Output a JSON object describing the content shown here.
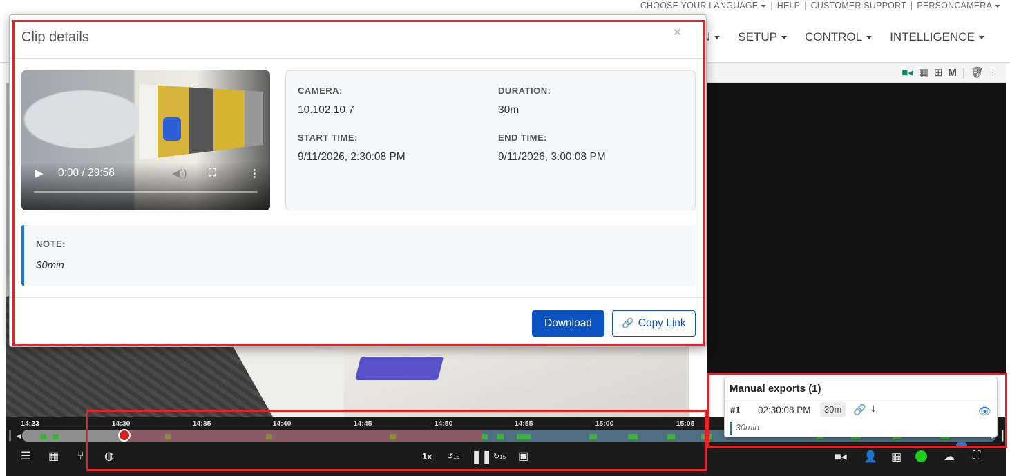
{
  "utility_bar": {
    "language": "CHOOSE YOUR LANGUAGE",
    "help": "HELP",
    "support": "CUSTOMER SUPPORT",
    "user": "PERSONCAMERA"
  },
  "main_nav": {
    "partial": "N",
    "setup": "SETUP",
    "control": "CONTROL",
    "intelligence": "INTELLIGENCE"
  },
  "camera_tools": {
    "m_label": "M"
  },
  "modal": {
    "title": "Clip details",
    "close": "×",
    "video": {
      "time": "0:00 / 29:58"
    },
    "camera_label": "CAMERA:",
    "camera_value": "10.102.10.7",
    "duration_label": "DURATION:",
    "duration_value": "30m",
    "start_label": "START TIME:",
    "start_value": "9/11/2026, 2:30:08 PM",
    "end_label": "END TIME:",
    "end_value": "9/11/2026, 3:00:08 PM",
    "note_label": "NOTE:",
    "note_value": "30min",
    "download": "Download",
    "copy_link": "Copy Link"
  },
  "timeline": {
    "ticks": [
      "14:23",
      "14:30",
      "14:35",
      "14:40",
      "14:45",
      "14:50",
      "14:55",
      "15:00",
      "15:05"
    ],
    "speed": "1x",
    "skip_back": "15",
    "skip_forward": "15"
  },
  "exports": {
    "title": "Manual exports (1)",
    "row": {
      "num": "#1",
      "time": "02:30:08 PM",
      "dur": "30m",
      "note": "30min"
    }
  },
  "colors": {
    "accent": "#0b52c2",
    "highlight_red": "#e0252a",
    "recording_green": "#3db33d",
    "status_green": "#18d118"
  }
}
